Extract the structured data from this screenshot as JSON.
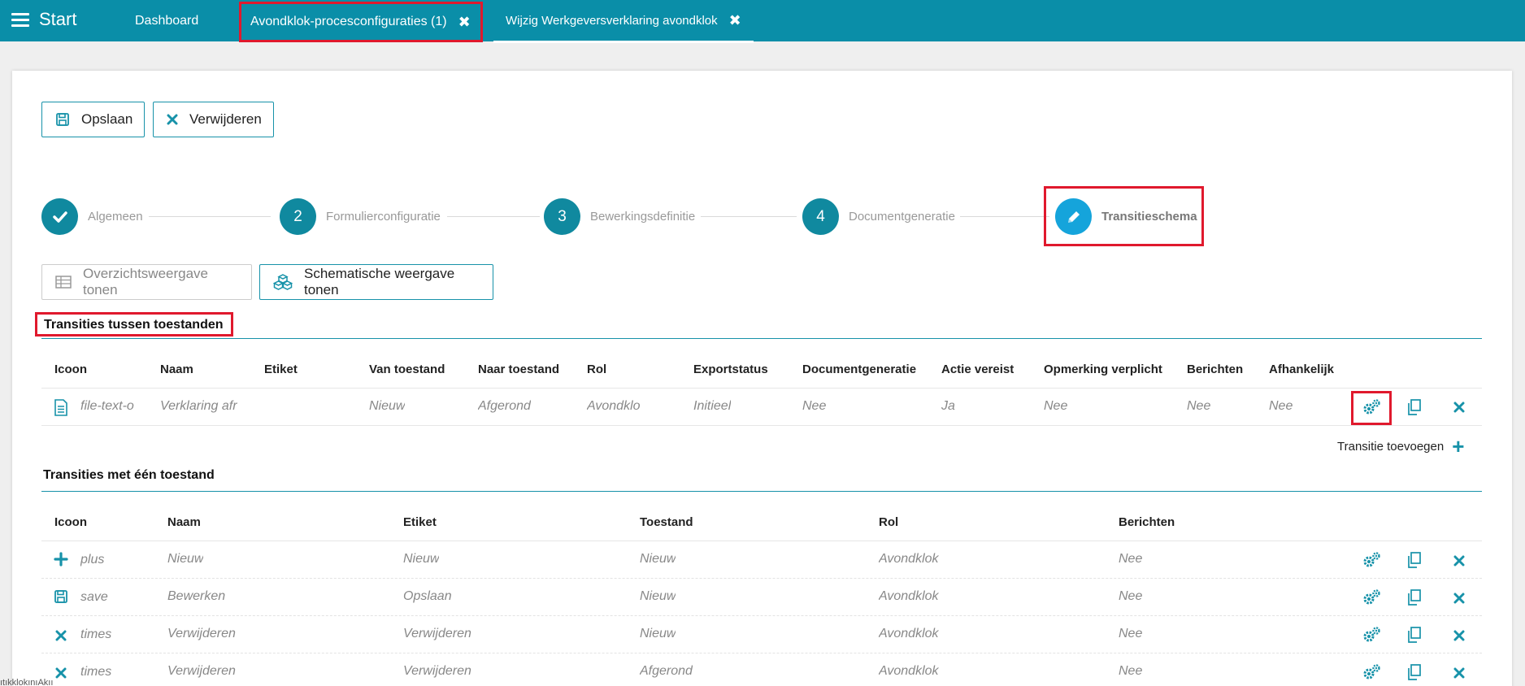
{
  "topbar": {
    "start_label": "Start",
    "tabs": [
      {
        "label": "Dashboard"
      },
      {
        "label": "Avondklok-procesconfiguraties (1)",
        "close": "✖"
      },
      {
        "label": "Wijzig Werkgeversverklaring avondklok",
        "close": "✖"
      }
    ]
  },
  "toolbar": {
    "save_label": "Opslaan",
    "delete_label": "Verwijderen"
  },
  "stepper": {
    "steps": [
      {
        "number": "",
        "label": "Algemeen",
        "state": "done"
      },
      {
        "number": "2",
        "label": "Formulierconfiguratie"
      },
      {
        "number": "3",
        "label": "Bewerkingsdefinitie"
      },
      {
        "number": "4",
        "label": "Documentgeneratie"
      },
      {
        "number": "",
        "label": "Transitieschema",
        "state": "active"
      }
    ]
  },
  "view_buttons": {
    "overview_label": "Overzichtsweergave tonen",
    "schema_label": "Schematische weergave tonen"
  },
  "transitions_between": {
    "title": "Transities tussen toestanden",
    "headers": [
      "Icoon",
      "Naam",
      "Etiket",
      "Van toestand",
      "Naar toestand",
      "Rol",
      "Exportstatus",
      "Documentgeneratie",
      "Actie vereist",
      "Opmerking verplicht",
      "Berichten",
      "Afhankelijk"
    ],
    "rows": [
      {
        "icon": "file-text-o",
        "icon_label": "file-text-o",
        "cells": [
          "Verklaring afr",
          "",
          "Nieuw",
          "Afgerond",
          "Avondklo",
          "Initieel",
          "Nee",
          "Ja",
          "Nee",
          "Nee",
          "Nee"
        ]
      }
    ],
    "add_label": "Transitie toevoegen"
  },
  "transitions_single": {
    "title": "Transities met één toestand",
    "headers": [
      "Icoon",
      "Naam",
      "Etiket",
      "Toestand",
      "Rol",
      "Berichten"
    ],
    "rows": [
      {
        "icon": "plus-icon",
        "icon_label": "plus",
        "cells": [
          "Nieuw",
          "Nieuw",
          "Nieuw",
          "Avondklok",
          "Nee"
        ]
      },
      {
        "icon": "save-icon",
        "icon_label": "save",
        "cells": [
          "Bewerken",
          "Opslaan",
          "Nieuw",
          "Avondklok",
          "Nee"
        ]
      },
      {
        "icon": "times-icon",
        "icon_label": "times",
        "cells": [
          "Verwijderen",
          "Verwijderen",
          "Nieuw",
          "Avondklok",
          "Nee"
        ]
      },
      {
        "icon": "times-icon",
        "icon_label": "times",
        "cells": [
          "Verwijderen",
          "Verwijderen",
          "Afgerond",
          "Avondklok",
          "Nee"
        ]
      }
    ]
  },
  "footer_text": "ıtıkklokınıAkıı",
  "colors": {
    "topbar": "#0a8ea8",
    "accent": "#1792a9",
    "highlight": "#e0192d",
    "active_step": "#15a4db"
  }
}
